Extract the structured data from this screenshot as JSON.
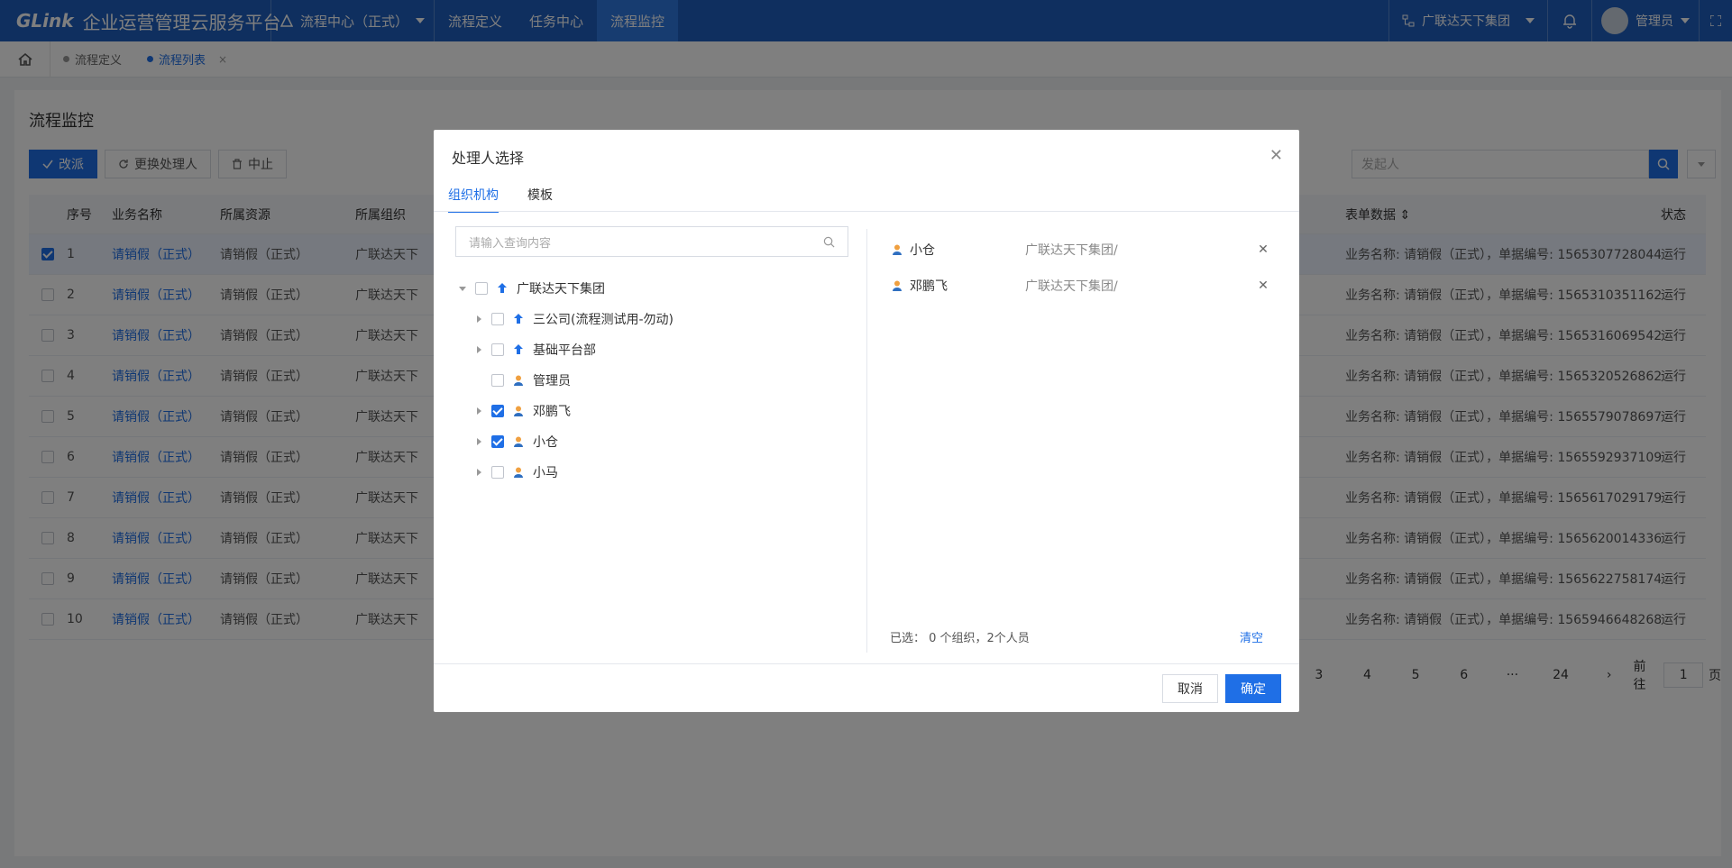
{
  "topbar": {
    "brand": "GLink",
    "platform": "企业运营管理云服务平台",
    "center": "流程中心（正式）",
    "nav": [
      "流程定义",
      "任务中心",
      "流程监控"
    ],
    "org": "广联达天下集团",
    "user": "管理员"
  },
  "tabs": {
    "def": "流程定义",
    "list": "流程列表",
    "close": "×"
  },
  "page": {
    "title": "流程监控"
  },
  "toolbar": {
    "reassign": "改派",
    "change_handler": "更换处理人",
    "stop": "中止"
  },
  "search": {
    "initiator_placeholder": "发起人"
  },
  "table": {
    "headers": {
      "no": "序号",
      "name": "业务名称",
      "res": "所属资源",
      "org": "所属组织",
      "form": "表单数据",
      "status": "状态"
    },
    "rows": [
      {
        "no": "1",
        "name": "请销假（正式）",
        "res": "请销假（正式）",
        "org": "广联达天下",
        "form": "业务名称: 请销假（正式），单据编号: 1565307728044",
        "status": "运行"
      },
      {
        "no": "2",
        "name": "请销假（正式）",
        "res": "请销假（正式）",
        "org": "广联达天下",
        "form": "业务名称: 请销假（正式），单据编号: 1565310351162",
        "status": "运行"
      },
      {
        "no": "3",
        "name": "请销假（正式）",
        "res": "请销假（正式）",
        "org": "广联达天下",
        "form": "业务名称: 请销假（正式），单据编号: 1565316069542",
        "status": "运行"
      },
      {
        "no": "4",
        "name": "请销假（正式）",
        "res": "请销假（正式）",
        "org": "广联达天下",
        "form": "业务名称: 请销假（正式），单据编号: 1565320526862",
        "status": "运行"
      },
      {
        "no": "5",
        "name": "请销假（正式）",
        "res": "请销假（正式）",
        "org": "广联达天下",
        "form": "业务名称: 请销假（正式），单据编号: 1565579078697",
        "status": "运行"
      },
      {
        "no": "6",
        "name": "请销假（正式）",
        "res": "请销假（正式）",
        "org": "广联达天下",
        "form": "业务名称: 请销假（正式），单据编号: 1565592937109",
        "status": "运行"
      },
      {
        "no": "7",
        "name": "请销假（正式）",
        "res": "请销假（正式）",
        "org": "广联达天下",
        "form": "业务名称: 请销假（正式），单据编号: 1565617029179",
        "status": "运行"
      },
      {
        "no": "8",
        "name": "请销假（正式）",
        "res": "请销假（正式）",
        "org": "广联达天下",
        "form": "业务名称: 请销假（正式），单据编号: 1565620014336",
        "status": "运行"
      },
      {
        "no": "9",
        "name": "请销假（正式）",
        "res": "请销假（正式）",
        "org": "广联达天下",
        "form": "业务名称: 请销假（正式），单据编号: 1565622758174",
        "status": "运行"
      },
      {
        "no": "10",
        "name": "请销假（正式）",
        "res": "请销假（正式）",
        "org": "广联达天下",
        "form": "业务名称: 请销假（正式），单据编号: 1565946648268",
        "status": "运行"
      }
    ]
  },
  "pagination": {
    "pages": [
      "3",
      "4",
      "5",
      "6",
      "···",
      "24"
    ],
    "goto": "前往",
    "goto_value": "1",
    "page_unit": "页"
  },
  "dialog": {
    "title": "处理人选择",
    "tabs": [
      "组织机构",
      "模板"
    ],
    "search_placeholder": "请输入查询内容",
    "tree": [
      {
        "label": "广联达天下集团",
        "type": "org"
      },
      {
        "label": "三公司(流程测试用-勿动)",
        "type": "org"
      },
      {
        "label": "基础平台部",
        "type": "org"
      },
      {
        "label": "管理员",
        "type": "person"
      },
      {
        "label": "邓鹏飞",
        "type": "person"
      },
      {
        "label": "小仓",
        "type": "person"
      },
      {
        "label": "小马",
        "type": "person"
      }
    ],
    "selected": [
      {
        "name": "小仓",
        "org": "广联达天下集团/"
      },
      {
        "name": "邓鹏飞",
        "org": "广联达天下集团/"
      }
    ],
    "summary": "已选：  0 个组织，2个人员",
    "clear": "清空",
    "cancel": "取消",
    "confirm": "确定"
  }
}
